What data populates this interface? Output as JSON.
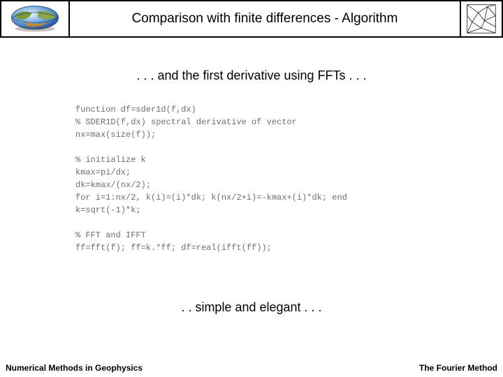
{
  "header": {
    "title": "Comparison with finite differences - Algorithm"
  },
  "subtitle": ". . . and the first derivative using FFTs . . .",
  "code": {
    "l1": "function df=sder1d(f,dx)",
    "l2": "% SDER1D(f,dx) spectral derivative of vector",
    "l3": "nx=max(size(f));",
    "l4": "% initialize k",
    "l5": "kmax=pi/dx;",
    "l6": "dk=kmax/(nx/2);",
    "l7": "for i=1:nx/2, k(i)=(i)*dk; k(nx/2+i)=-kmax+(i)*dk; end",
    "l8": "k=sqrt(-1)*k;",
    "l9": "% FFT and IFFT",
    "l10": "ff=fft(f); ff=k.*ff; df=real(ifft(ff));"
  },
  "closing": ". . simple and elegant . . .",
  "footer": {
    "left": "Numerical Methods in Geophysics",
    "right": "The Fourier Method"
  }
}
